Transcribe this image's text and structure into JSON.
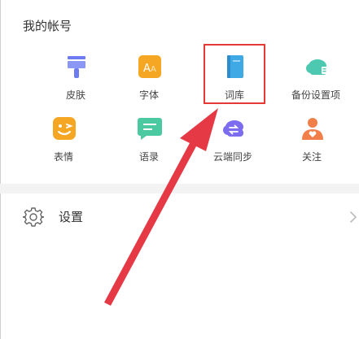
{
  "section": {
    "title": "我的帐号"
  },
  "grid": {
    "items": [
      {
        "label": "皮肤",
        "icon": "brush-icon"
      },
      {
        "label": "字体",
        "icon": "font-icon"
      },
      {
        "label": "词库",
        "icon": "book-icon"
      },
      {
        "label": "备份设置项",
        "icon": "cloud-backup-icon"
      },
      {
        "label": "表情",
        "icon": "emoji-icon"
      },
      {
        "label": "语录",
        "icon": "quote-bubble-icon"
      },
      {
        "label": "云端同步",
        "icon": "cloud-sync-icon"
      },
      {
        "label": "关注",
        "icon": "follow-person-icon"
      }
    ]
  },
  "settings": {
    "label": "设置",
    "icon": "gear-icon"
  },
  "colors": {
    "highlight": "#e53935",
    "arrow": "#e63946",
    "brush": "#6c7cf0",
    "font": "#f5a623",
    "book": "#3fa9e6",
    "cloud": "#4cc9b0",
    "emoji": "#f5a623",
    "quote": "#4cc9a0",
    "sync": "#7b6cf0",
    "follow": "#f07f4a"
  }
}
